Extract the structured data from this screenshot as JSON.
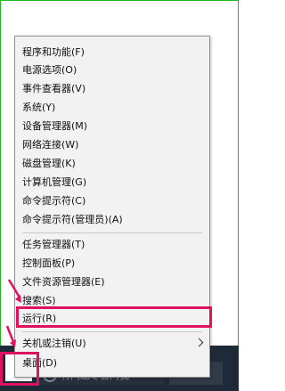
{
  "menu": {
    "items": [
      {
        "label": "程序和功能(F)"
      },
      {
        "label": "电源选项(O)"
      },
      {
        "label": "事件查看器(V)"
      },
      {
        "label": "系统(Y)"
      },
      {
        "label": "设备管理器(M)"
      },
      {
        "label": "网络连接(W)"
      },
      {
        "label": "磁盘管理(K)"
      },
      {
        "label": "计算机管理(G)"
      },
      {
        "label": "命令提示符(C)"
      },
      {
        "label": "命令提示符(管理员)(A)"
      },
      {
        "label": "任务管理器(T)"
      },
      {
        "label": "控制面板(P)"
      },
      {
        "label": "文件资源管理器(E)"
      },
      {
        "label": "搜索(S)"
      },
      {
        "label": "运行(R)"
      },
      {
        "label": "关机或注销(U)"
      },
      {
        "label": "桌面(D)"
      }
    ]
  },
  "taskbar": {
    "search_text": "有问题尽管问我"
  },
  "colors": {
    "highlight": "#e0115f",
    "menu_bg": "#f2f2f2",
    "taskbar": "#1f2a38",
    "windows_blue": "#0e6fc5"
  }
}
